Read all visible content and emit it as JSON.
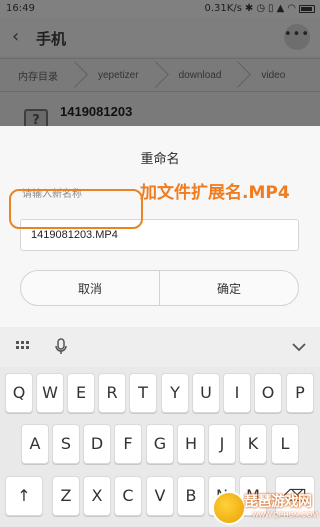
{
  "status_bar": {
    "time": "16:49",
    "network_speed": "0.31K/s",
    "icons": [
      "bluetooth-icon",
      "alarm-icon",
      "vibrate-icon",
      "signal-icon",
      "wifi-icon",
      "battery-icon"
    ]
  },
  "header": {
    "title": "手机",
    "back_icon": "chevron-left-icon",
    "more_icon": "more-dots-icon"
  },
  "breadcrumb": [
    "内存目录",
    "yepetizer",
    "download",
    "video"
  ],
  "file": {
    "name": "1419081203",
    "icon": "unknown-file-icon"
  },
  "dialog": {
    "title": "重命名",
    "hint": "请输入新名称",
    "annotation": "加文件扩展名.MP4",
    "input_value": "1419081203.MP4",
    "cancel_label": "取消",
    "confirm_label": "确定",
    "highlight_color": "#ea8326",
    "annotation_color": "#f07c1f"
  },
  "keyboard": {
    "toolbar_icons": [
      "grid-icon",
      "mic-icon",
      "chevron-down-icon"
    ],
    "row1": [
      "Q",
      "W",
      "E",
      "R",
      "T",
      "Y",
      "U",
      "I",
      "O",
      "P"
    ],
    "row2": [
      "A",
      "S",
      "D",
      "F",
      "G",
      "H",
      "J",
      "K",
      "L"
    ],
    "row3": [
      "↑",
      "Z",
      "X",
      "C",
      "V",
      "B",
      "N",
      "M",
      "⌫"
    ]
  },
  "watermark": {
    "text": "琵琶游戏网",
    "url": "WWW.QPHGM.COM"
  }
}
